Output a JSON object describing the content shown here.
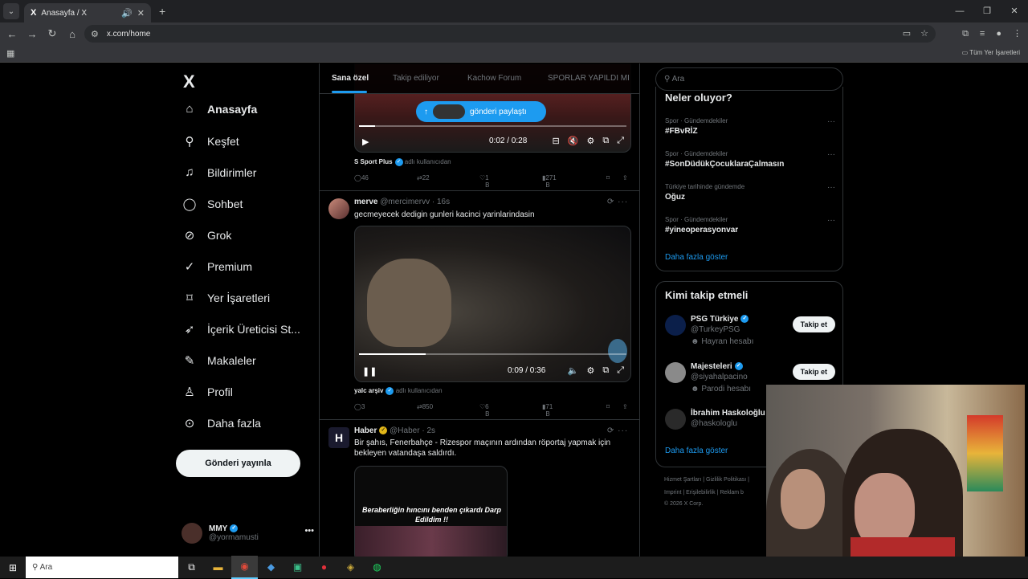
{
  "browser": {
    "tab_title": "Anasayfa / X",
    "tab_logo": "X",
    "url": "x.com/home",
    "bookmarks_all": "Tüm Yer İşaretleri"
  },
  "sidebar": {
    "logo": "X",
    "items": [
      {
        "label": "Anasayfa",
        "icon": "home-icon"
      },
      {
        "label": "Keşfet",
        "icon": "search-icon"
      },
      {
        "label": "Bildirimler",
        "icon": "bell-icon"
      },
      {
        "label": "Sohbet",
        "icon": "chat-icon"
      },
      {
        "label": "Grok",
        "icon": "grok-icon"
      },
      {
        "label": "Premium",
        "icon": "premium-icon"
      },
      {
        "label": "Yer İşaretleri",
        "icon": "bookmark-icon"
      },
      {
        "label": "İçerik Üreticisi St...",
        "icon": "rocket-icon"
      },
      {
        "label": "Makaleler",
        "icon": "article-icon"
      },
      {
        "label": "Profil",
        "icon": "user-icon"
      },
      {
        "label": "Daha fazla",
        "icon": "more-circle-icon"
      }
    ],
    "post_button": "Gönderi yayınla",
    "account": {
      "name": "MMY",
      "handle": "@yormamusti"
    }
  },
  "timeline": {
    "tabs": [
      "Sana özel",
      "Takip ediliyor",
      "Kachow Forum",
      "SPORLAR YAPILDI MI"
    ],
    "share_pill": "gönderi paylaştı",
    "tweets": [
      {
        "video_time": "0:02 / 0:28",
        "video_progress": 0.06,
        "attribution_name": "S Sport Plus",
        "attribution_suffix": "adlı kullanıcıdan",
        "replies": "46",
        "reposts": "22",
        "likes": "1 B",
        "views": "271 B"
      },
      {
        "name": "merve",
        "handle": "@mercimervv",
        "time": "16s",
        "text": "gecmeyecek dedigin gunleri kacinci yarinlarindasin",
        "video_time": "0:09 / 0:36",
        "video_progress": 0.25,
        "attribution_name": "yalc arşiv",
        "attribution_suffix": "adlı kullanıcıdan",
        "replies": "3",
        "reposts": "850",
        "likes": "6 B",
        "views": "71 B"
      },
      {
        "name": "Haber",
        "handle": "@Haber",
        "time": "2s",
        "avatar_letter": "H",
        "text": "Bir şahıs, Fenerbahçe - Rizespor maçının ardından röportaj yapmak için bekleyen vatandaşa saldırdı.",
        "image_caption": "Beraberliğin hıncını benden çıkardı Darp Edildim !!"
      }
    ]
  },
  "right": {
    "search_placeholder": "Ara",
    "trends_title": "Neler oluyor?",
    "trends": [
      {
        "category": "Spor · Gündemdekiler",
        "name": "#FBvRİZ"
      },
      {
        "category": "Spor · Gündemdekiler",
        "name": "#SonDüdükÇocuklaraÇalmasın"
      },
      {
        "category": "Türkiye tarihinde gündemde",
        "name": "Oğuz"
      },
      {
        "category": "Spor · Gündemdekiler",
        "name": "#yineoperasyonvar"
      }
    ],
    "trends_more": "Daha fazla göster",
    "who_title": "Kimi takip etmeli",
    "who": [
      {
        "name": "PSG Türkiye",
        "handle": "@TurkeyPSG",
        "label": "Hayran hesabı",
        "button": "Takip et"
      },
      {
        "name": "Majesteleri",
        "handle": "@siyahalpacino",
        "label": "Parodi hesabı",
        "button": "Takip et"
      },
      {
        "name": "İbrahim Haskoloğlu",
        "handle": "@haskologlu",
        "label": "",
        "button": ""
      }
    ],
    "who_more": "Daha fazla göster",
    "footer": {
      "line1": "Hizmet Şartları  |  Gizlilik Politikası  |",
      "line2": "Imprint  |  Erişilebilirlik  |  Reklam b",
      "line3": "© 2026 X Corp."
    }
  },
  "taskbar": {
    "search": "Ara"
  }
}
